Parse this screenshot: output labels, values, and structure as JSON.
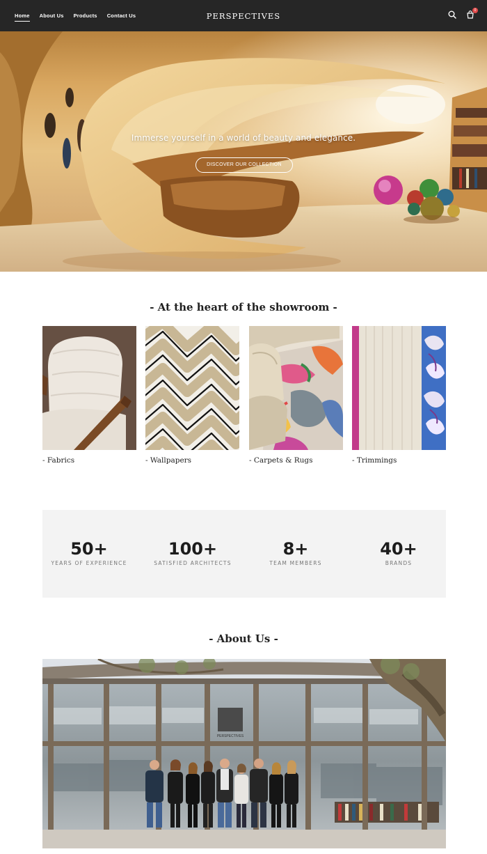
{
  "nav": {
    "links": [
      "Home",
      "About Us",
      "Products",
      "Contact Us"
    ],
    "active": "Home",
    "brand": "PERSPECTIVES",
    "cart_count": "0"
  },
  "hero": {
    "tagline": "Immerse yourself in a world of beauty and elegance.",
    "button_label": "DISCOVER OUR COLLECTION"
  },
  "showroom": {
    "title": "- At the heart of the showroom -",
    "categories": [
      {
        "label": "- Fabrics"
      },
      {
        "label": "- Wallpapers"
      },
      {
        "label": "- Carpets & Rugs"
      },
      {
        "label": "- Trimmings"
      }
    ]
  },
  "stats": [
    {
      "value": "50+",
      "label": "YEARS OF EXPERIENCE"
    },
    {
      "value": "100+",
      "label": "SATISFIED ARCHITECTS"
    },
    {
      "value": "8+",
      "label": "TEAM MEMBERS"
    },
    {
      "value": "40+",
      "label": "BRANDS"
    }
  ],
  "about": {
    "title": "- About Us -",
    "sign_text": "PERSPECTIVES"
  },
  "colors": {
    "navbar_bg": "#262626",
    "stats_bg": "#f3f3f3",
    "badge": "#e04848"
  },
  "icons": [
    "search-icon",
    "cart-icon"
  ]
}
